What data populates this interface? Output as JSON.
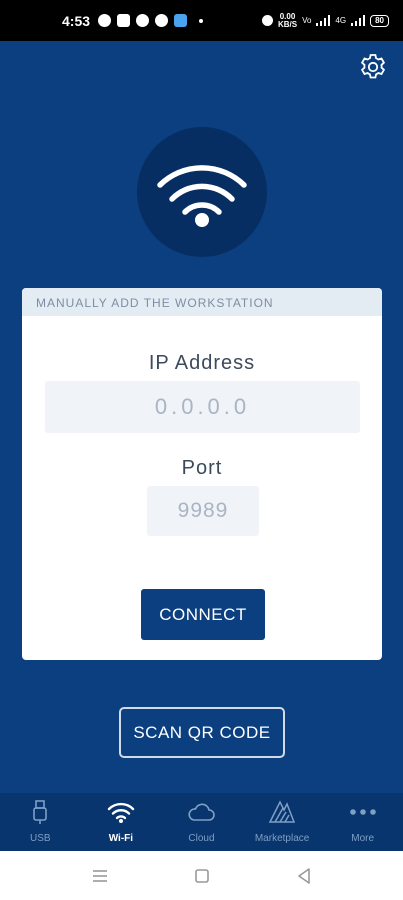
{
  "status_bar": {
    "time": "4:53",
    "net_speed_top": "0.00",
    "net_speed_bottom": "KB/S",
    "network_1": "Vo",
    "network_2": "4G",
    "battery": "80"
  },
  "icons": {
    "settings": "gear-icon",
    "hero": "wifi-icon",
    "usb": "usb-icon",
    "wifi_tab": "wifi-icon",
    "cloud": "cloud-icon",
    "marketplace": "marketplace-icon",
    "more": "more-dots-icon"
  },
  "card": {
    "header": "MANUALLY ADD THE WORKSTATION",
    "ip_label": "IP Address",
    "ip_placeholder": "0.0.0.0",
    "port_label": "Port",
    "port_placeholder": "9989",
    "connect_label": "CONNECT"
  },
  "scan_label": "SCAN QR CODE",
  "tabs": [
    {
      "label": "USB",
      "active": false
    },
    {
      "label": "Wi-Fi",
      "active": true
    },
    {
      "label": "Cloud",
      "active": false
    },
    {
      "label": "Marketplace",
      "active": false
    },
    {
      "label": "More",
      "active": false
    }
  ],
  "colors": {
    "background": "#0b3f80",
    "hero_circle": "#072e62",
    "tab_bar": "#08356d",
    "card": "#ffffff"
  }
}
